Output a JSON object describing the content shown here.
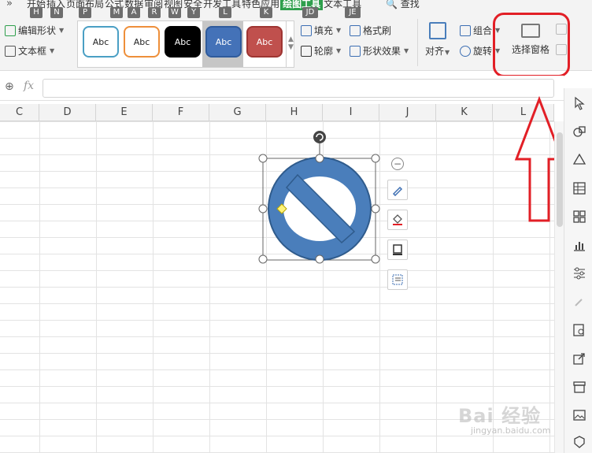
{
  "menu": {
    "more": "»",
    "tabs": [
      "开始",
      "插入",
      "页面布局",
      "公式",
      "数据",
      "审阅",
      "视图",
      "安全",
      "开发工具",
      "特色应用",
      "绘图工具",
      "文本工具"
    ],
    "active_tab": "绘图工具",
    "search": "查找"
  },
  "keytips": [
    "H",
    "N",
    "P",
    "M",
    "A",
    "R",
    "W",
    "Y",
    "L",
    "K",
    "JD",
    "JE"
  ],
  "ribbon": {
    "edit_shape": "编辑形状",
    "text_box": "文本框",
    "style_swatch_label": "Abc",
    "fill": "填充",
    "format_painter": "格式刷",
    "outline": "轮廓",
    "shape_effect": "形状效果",
    "align": "对齐",
    "group": "组合",
    "rotate": "旋转",
    "selection_pane": "选择窗格"
  },
  "formula_bar": {
    "fx": "fx",
    "value": ""
  },
  "columns": [
    "C",
    "D",
    "E",
    "F",
    "G",
    "H",
    "I",
    "J",
    "K",
    "L"
  ],
  "watermark": {
    "brand": "Bai 经验",
    "url": "jingyan.baidu.com"
  },
  "colors": {
    "accent_green": "#2e9f4c",
    "shape_fill": "#4a7ebb",
    "shape_stroke": "#2f5b8c",
    "annotation_red": "#e21f26"
  }
}
